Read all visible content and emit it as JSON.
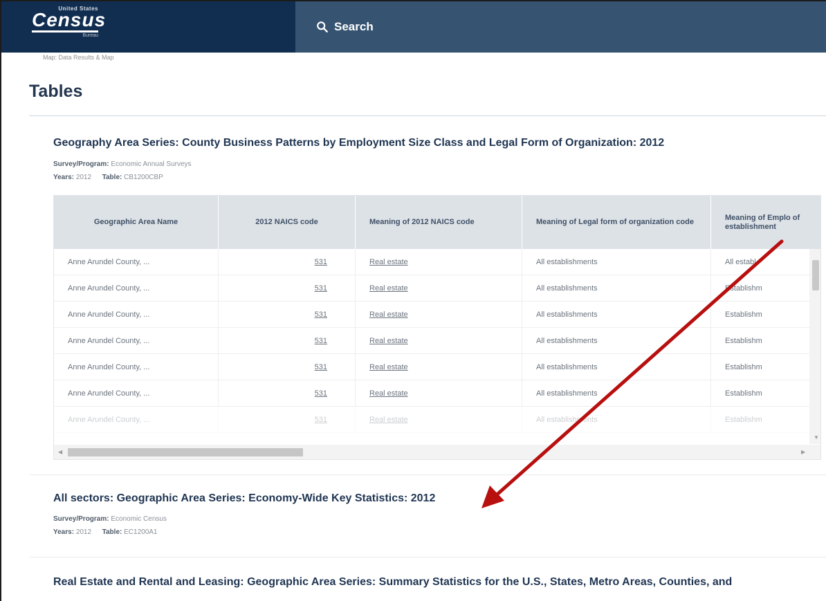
{
  "header": {
    "logo_top": "United States",
    "logo_main": "Census",
    "logo_bottom": "Bureau",
    "search_label": "Search"
  },
  "breadcrumb": "Map: Data Results & Map",
  "page_title": "Tables",
  "results": [
    {
      "title": "Geography Area Series: County Business Patterns by Employment Size Class and Legal Form of Organization: 2012",
      "survey_label": "Survey/Program:",
      "survey_value": "Economic Annual Surveys",
      "years_label": "Years:",
      "years_value": "2012",
      "table_label": "Table:",
      "table_value": "CB1200CBP"
    },
    {
      "title": "All sectors: Geographic Area Series: Economy-Wide Key Statistics: 2012",
      "survey_label": "Survey/Program:",
      "survey_value": "Economic Census",
      "years_label": "Years:",
      "years_value": "2012",
      "table_label": "Table:",
      "table_value": "EC1200A1"
    },
    {
      "title": "Real Estate and Rental and Leasing: Geographic Area Series: Summary Statistics for the U.S., States, Metro Areas, Counties, and"
    }
  ],
  "table": {
    "headers": [
      "Geographic Area Name",
      "2012 NAICS code",
      "Meaning of 2012 NAICS code",
      "Meaning of Legal form of organization code",
      "Meaning of Emplo of establishment"
    ],
    "rows": [
      [
        "Anne Arundel County, ...",
        "531",
        "Real estate",
        "All establishments",
        "All establ"
      ],
      [
        "Anne Arundel County, ...",
        "531",
        "Real estate",
        "All establishments",
        "Establishm"
      ],
      [
        "Anne Arundel County, ...",
        "531",
        "Real estate",
        "All establishments",
        "Establishm"
      ],
      [
        "Anne Arundel County, ...",
        "531",
        "Real estate",
        "All establishments",
        "Establishm"
      ],
      [
        "Anne Arundel County, ...",
        "531",
        "Real estate",
        "All establishments",
        "Establishm"
      ],
      [
        "Anne Arundel County, ...",
        "531",
        "Real estate",
        "All establishments",
        "Establishm"
      ],
      [
        "Anne Arundel County, ...",
        "531",
        "Real estate",
        "All establishments",
        "Establishm"
      ]
    ]
  },
  "colors": {
    "header_dark": "#112e51",
    "header_search": "#365472",
    "annotation_arrow": "#b80f0f"
  }
}
